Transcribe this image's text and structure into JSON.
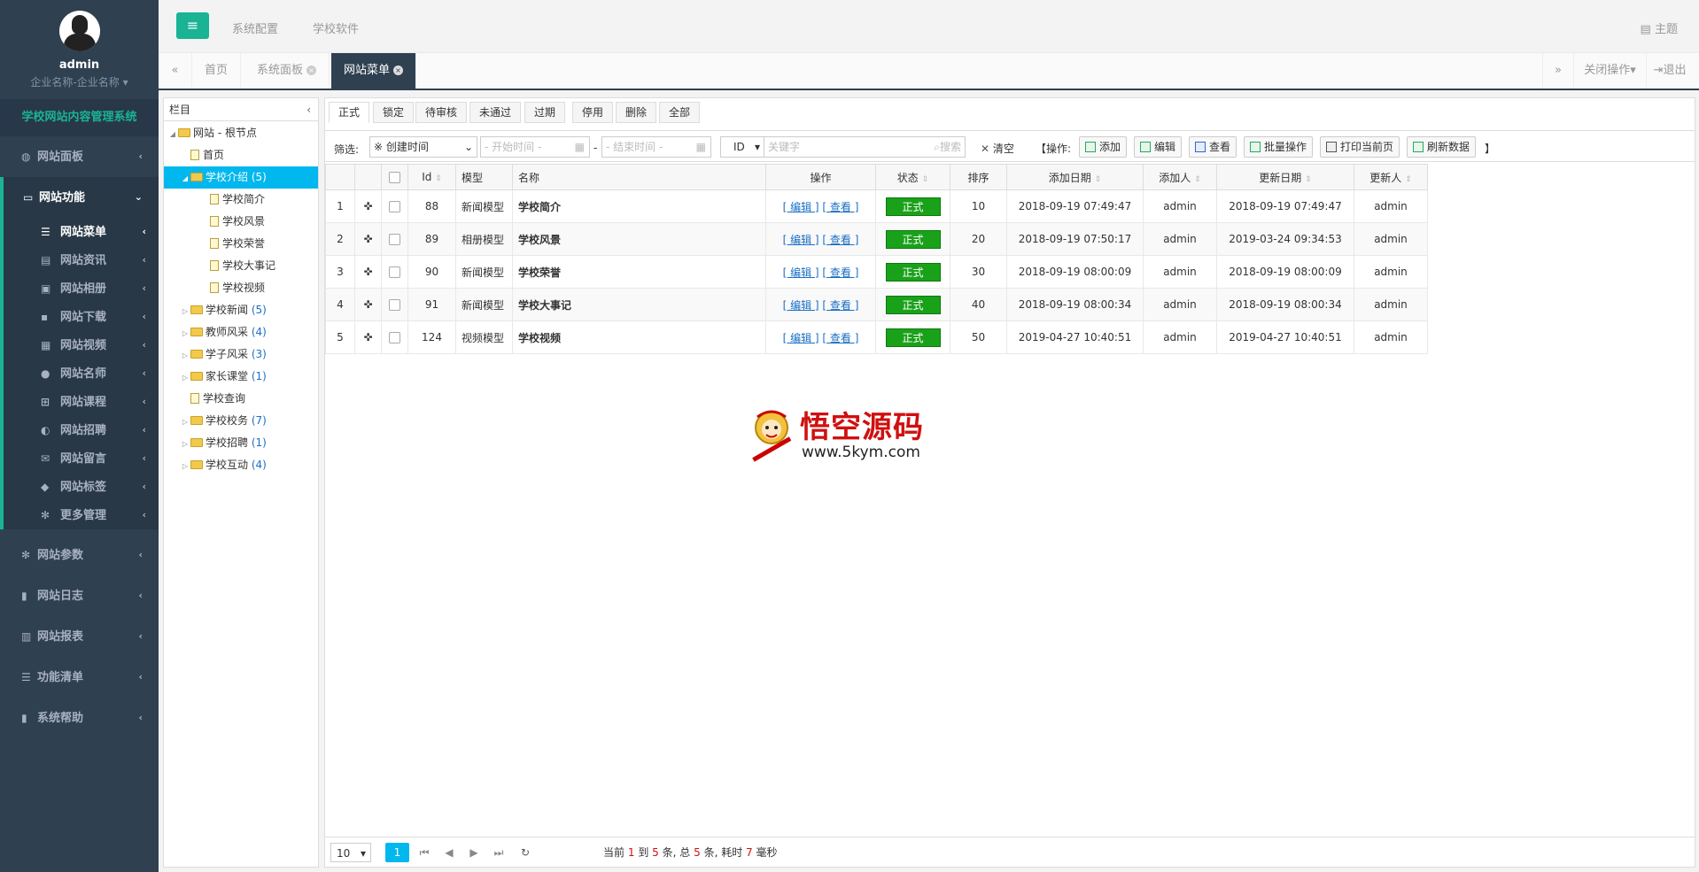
{
  "profile": {
    "name": "admin",
    "company": "企业名称-企业名称"
  },
  "system_name": "学校网站内容管理系统",
  "menu": {
    "dashboard": "网站面板",
    "functions": "网站功能",
    "function_items": [
      "网站菜单",
      "网站资讯",
      "网站相册",
      "网站下载",
      "网站视频",
      "网站名师",
      "网站课程",
      "网站招聘",
      "网站留言",
      "网站标签",
      "更多管理"
    ],
    "params": "网站参数",
    "logs": "网站日志",
    "reports": "网站报表",
    "feature_list": "功能清单",
    "help": "系统帮助"
  },
  "topbar": {
    "nav1": "系统配置",
    "nav2": "学校软件",
    "theme": "主题"
  },
  "tabs": {
    "home": "首页",
    "panel": "系统面板",
    "menu": "网站菜单",
    "close_ops": "关闭操作",
    "logout": "退出"
  },
  "tree": {
    "header": "栏目",
    "root": "网站 - 根节点",
    "home": "首页",
    "selected": {
      "label": "学校介绍",
      "count": "(5)"
    },
    "children": [
      "学校简介",
      "学校风景",
      "学校荣誉",
      "学校大事记",
      "学校视频"
    ],
    "news": {
      "label": "学校新闻",
      "count": "(5)"
    },
    "teachers": {
      "label": "教师风采",
      "count": "(4)"
    },
    "students": {
      "label": "学子风采",
      "count": "(3)"
    },
    "parents": {
      "label": "家长课堂",
      "count": "(1)"
    },
    "query": "学校查询",
    "affairs": {
      "label": "学校校务",
      "count": "(7)"
    },
    "recruit": {
      "label": "学校招聘",
      "count": "(1)"
    },
    "interact": {
      "label": "学校互动",
      "count": "(4)"
    }
  },
  "status_tabs": [
    "正式",
    "锁定",
    "待审核",
    "未通过",
    "过期",
    "停用",
    "删除",
    "全部"
  ],
  "filter": {
    "label": "筛选:",
    "date_field": "※ 创建时间",
    "start_placeholder": "- 开始时间 -",
    "end_placeholder": "- 结束时间 -",
    "key_field": "ID",
    "keyword_placeholder": "关键字",
    "search": "搜索",
    "clear": "清空",
    "ops_label": "【操作:",
    "ops_end": "】",
    "add": "添加",
    "edit": "编辑",
    "view": "查看",
    "batch": "批量操作",
    "print": "打印当前页",
    "refresh": "刷新数据"
  },
  "columns": [
    "Id",
    "模型",
    "名称",
    "操作",
    "状态",
    "排序",
    "添加日期",
    "添加人",
    "更新日期",
    "更新人"
  ],
  "rows": [
    {
      "n": "1",
      "id": "88",
      "model": "新闻模型",
      "name": "学校简介",
      "status": "正式",
      "sort": "10",
      "added": "2018-09-19 07:49:47",
      "adder": "admin",
      "updated": "2018-09-19 07:49:47",
      "updater": "admin"
    },
    {
      "n": "2",
      "id": "89",
      "model": "相册模型",
      "name": "学校风景",
      "status": "正式",
      "sort": "20",
      "added": "2018-09-19 07:50:17",
      "adder": "admin",
      "updated": "2019-03-24 09:34:53",
      "updater": "admin"
    },
    {
      "n": "3",
      "id": "90",
      "model": "新闻模型",
      "name": "学校荣誉",
      "status": "正式",
      "sort": "30",
      "added": "2018-09-19 08:00:09",
      "adder": "admin",
      "updated": "2018-09-19 08:00:09",
      "updater": "admin"
    },
    {
      "n": "4",
      "id": "91",
      "model": "新闻模型",
      "name": "学校大事记",
      "status": "正式",
      "sort": "40",
      "added": "2018-09-19 08:00:34",
      "adder": "admin",
      "updated": "2018-09-19 08:00:34",
      "updater": "admin"
    },
    {
      "n": "5",
      "id": "124",
      "model": "视频模型",
      "name": "学校视频",
      "status": "正式",
      "sort": "50",
      "added": "2019-04-27 10:40:51",
      "adder": "admin",
      "updated": "2019-04-27 10:40:51",
      "updater": "admin"
    }
  ],
  "row_actions": {
    "edit": "[ 编辑 ]",
    "view": "[ 查看 ]"
  },
  "watermark": {
    "title": "悟空源码",
    "url": "www.5kym.com"
  },
  "pager": {
    "page_size": "10",
    "current_page": "1",
    "info_prefix": "当前",
    "from": "1",
    "to_label": "到",
    "to": "5",
    "items_label": "条, 总",
    "total": "5",
    "time_label": "条, 耗时",
    "ms": "7",
    "ms_label": "毫秒"
  },
  "colors": {
    "sidebar": "#2f4050",
    "accent": "#1ab394",
    "selected_tree": "#00b7ee",
    "status_green": "#1aa11a"
  }
}
